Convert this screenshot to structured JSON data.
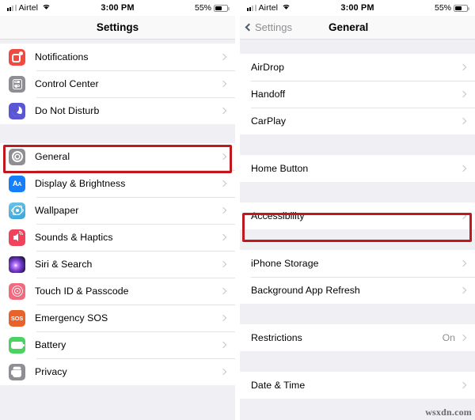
{
  "left_screen": {
    "status_bar": {
      "carrier": "Airtel",
      "time": "3:00 PM",
      "battery_percent": "55%",
      "battery_level": 55,
      "signal_icon": "cellular-bars-icon",
      "wifi_icon": "wifi-icon",
      "battery_icon": "battery-icon"
    },
    "nav": {
      "title": "Settings"
    },
    "groups": [
      {
        "rows": [
          {
            "label": "Notifications",
            "icon": "notifications-icon",
            "icon_color": "#ef4b42",
            "accessory": "chevron-right-icon"
          },
          {
            "label": "Control Center",
            "icon": "control-center-icon",
            "icon_color": "#8e8e93",
            "accessory": "chevron-right-icon"
          },
          {
            "label": "Do Not Disturb",
            "icon": "do-not-disturb-icon",
            "icon_color": "#5a56d6",
            "accessory": "chevron-right-icon"
          }
        ]
      },
      {
        "rows": [
          {
            "label": "General",
            "icon": "gear-icon",
            "icon_color": "#8e8e93",
            "accessory": "chevron-right-icon",
            "highlighted": true
          },
          {
            "label": "Display & Brightness",
            "icon": "display-brightness-icon",
            "icon_color": "#147efb",
            "accessory": "chevron-right-icon"
          },
          {
            "label": "Wallpaper",
            "icon": "wallpaper-icon",
            "icon_color": "#3ba4d8",
            "accessory": "chevron-right-icon"
          },
          {
            "label": "Sounds & Haptics",
            "icon": "sounds-haptics-icon",
            "icon_color": "#f0425a",
            "accessory": "chevron-right-icon"
          },
          {
            "label": "Siri & Search",
            "icon": "siri-icon",
            "icon_color": "#2a1a5c",
            "accessory": "chevron-right-icon"
          },
          {
            "label": "Touch ID & Passcode",
            "icon": "touch-id-icon",
            "icon_color": "#f16b7e",
            "accessory": "chevron-right-icon"
          },
          {
            "label": "Emergency SOS",
            "icon": "sos-icon",
            "icon_color": "#e8622a",
            "accessory": "chevron-right-icon"
          },
          {
            "label": "Battery",
            "icon": "battery-icon",
            "icon_color": "#4cd263",
            "accessory": "chevron-right-icon"
          },
          {
            "label": "Privacy",
            "icon": "privacy-hand-icon",
            "icon_color": "#8e8e93",
            "accessory": "chevron-right-icon"
          }
        ]
      }
    ]
  },
  "right_screen": {
    "status_bar": {
      "carrier": "Airtel",
      "time": "3:00 PM",
      "battery_percent": "55%",
      "battery_level": 55,
      "signal_icon": "cellular-bars-icon",
      "wifi_icon": "wifi-icon",
      "battery_icon": "battery-icon"
    },
    "nav": {
      "back_label": "Settings",
      "back_icon": "chevron-left-icon",
      "title": "General"
    },
    "groups": [
      {
        "rows": [
          {
            "label": "AirDrop",
            "accessory": "chevron-right-icon"
          },
          {
            "label": "Handoff",
            "accessory": "chevron-right-icon"
          },
          {
            "label": "CarPlay",
            "accessory": "chevron-right-icon"
          }
        ]
      },
      {
        "rows": [
          {
            "label": "Home Button",
            "accessory": "chevron-right-icon"
          }
        ]
      },
      {
        "rows": [
          {
            "label": "Accessibility",
            "accessory": "chevron-right-icon",
            "highlighted": true
          }
        ]
      },
      {
        "rows": [
          {
            "label": "iPhone Storage",
            "accessory": "chevron-right-icon"
          },
          {
            "label": "Background App Refresh",
            "accessory": "chevron-right-icon"
          }
        ]
      },
      {
        "rows": [
          {
            "label": "Restrictions",
            "value": "On",
            "accessory": "chevron-right-icon"
          }
        ]
      },
      {
        "rows": [
          {
            "label": "Date & Time",
            "accessory": "chevron-right-icon"
          }
        ]
      }
    ]
  },
  "watermark": "wsxdn.com",
  "colors": {
    "highlight": "#c0181e",
    "group_bg": "#efeff4",
    "row_bg": "#ffffff",
    "accessory": "#c4c4c6",
    "secondary_text": "#8e8e93"
  }
}
